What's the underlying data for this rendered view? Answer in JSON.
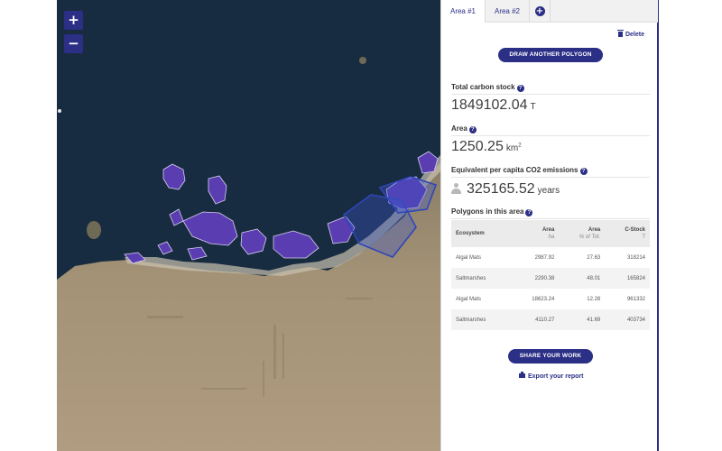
{
  "map": {
    "zoom_in_label": "+",
    "zoom_out_label": "−",
    "colors": {
      "sea": "#182c41",
      "land": "#9a8a70",
      "mangrove": "#5a3db0",
      "selection": "#2f46b8"
    }
  },
  "panel": {
    "tabs": [
      {
        "label": "Area #1",
        "active": true
      },
      {
        "label": "Area #2",
        "active": false
      }
    ],
    "add_tab_icon": "plus-circle-icon",
    "add_tab_label": "+",
    "delete_label": "Delete",
    "draw_button_label": "DRAW ANOTHER POLYGON",
    "total_carbon": {
      "label": "Total carbon stock",
      "value": "1849102.04",
      "unit": "T"
    },
    "area": {
      "label": "Area",
      "value": "1250.25",
      "unit": "km",
      "unit_sup": "2"
    },
    "equivalent": {
      "label": "Equivalent per capita CO2 emissions",
      "value": "325165.52",
      "unit": "years"
    },
    "help_glyph": "?",
    "polygons": {
      "label": "Polygons in this area",
      "columns": [
        {
          "title": "Ecosystem",
          "sub": ""
        },
        {
          "title": "Area",
          "sub": "ha"
        },
        {
          "title": "Area",
          "sub": "% of Tot."
        },
        {
          "title": "C-Stock",
          "sub": "T"
        }
      ],
      "rows": [
        [
          "Algal Mats",
          "2987.92",
          "27.63",
          "318214"
        ],
        [
          "Saltmarshes",
          "2290.38",
          "48.01",
          "165824"
        ],
        [
          "Algal Mats",
          "18623.24",
          "12.28",
          "961332"
        ],
        [
          "Saltmarshes",
          "4110.27",
          "41.69",
          "403734"
        ]
      ]
    },
    "share_button_label": "SHARE YOUR WORK",
    "export_label": "Export your report",
    "accent_color": "#2b2f86"
  }
}
